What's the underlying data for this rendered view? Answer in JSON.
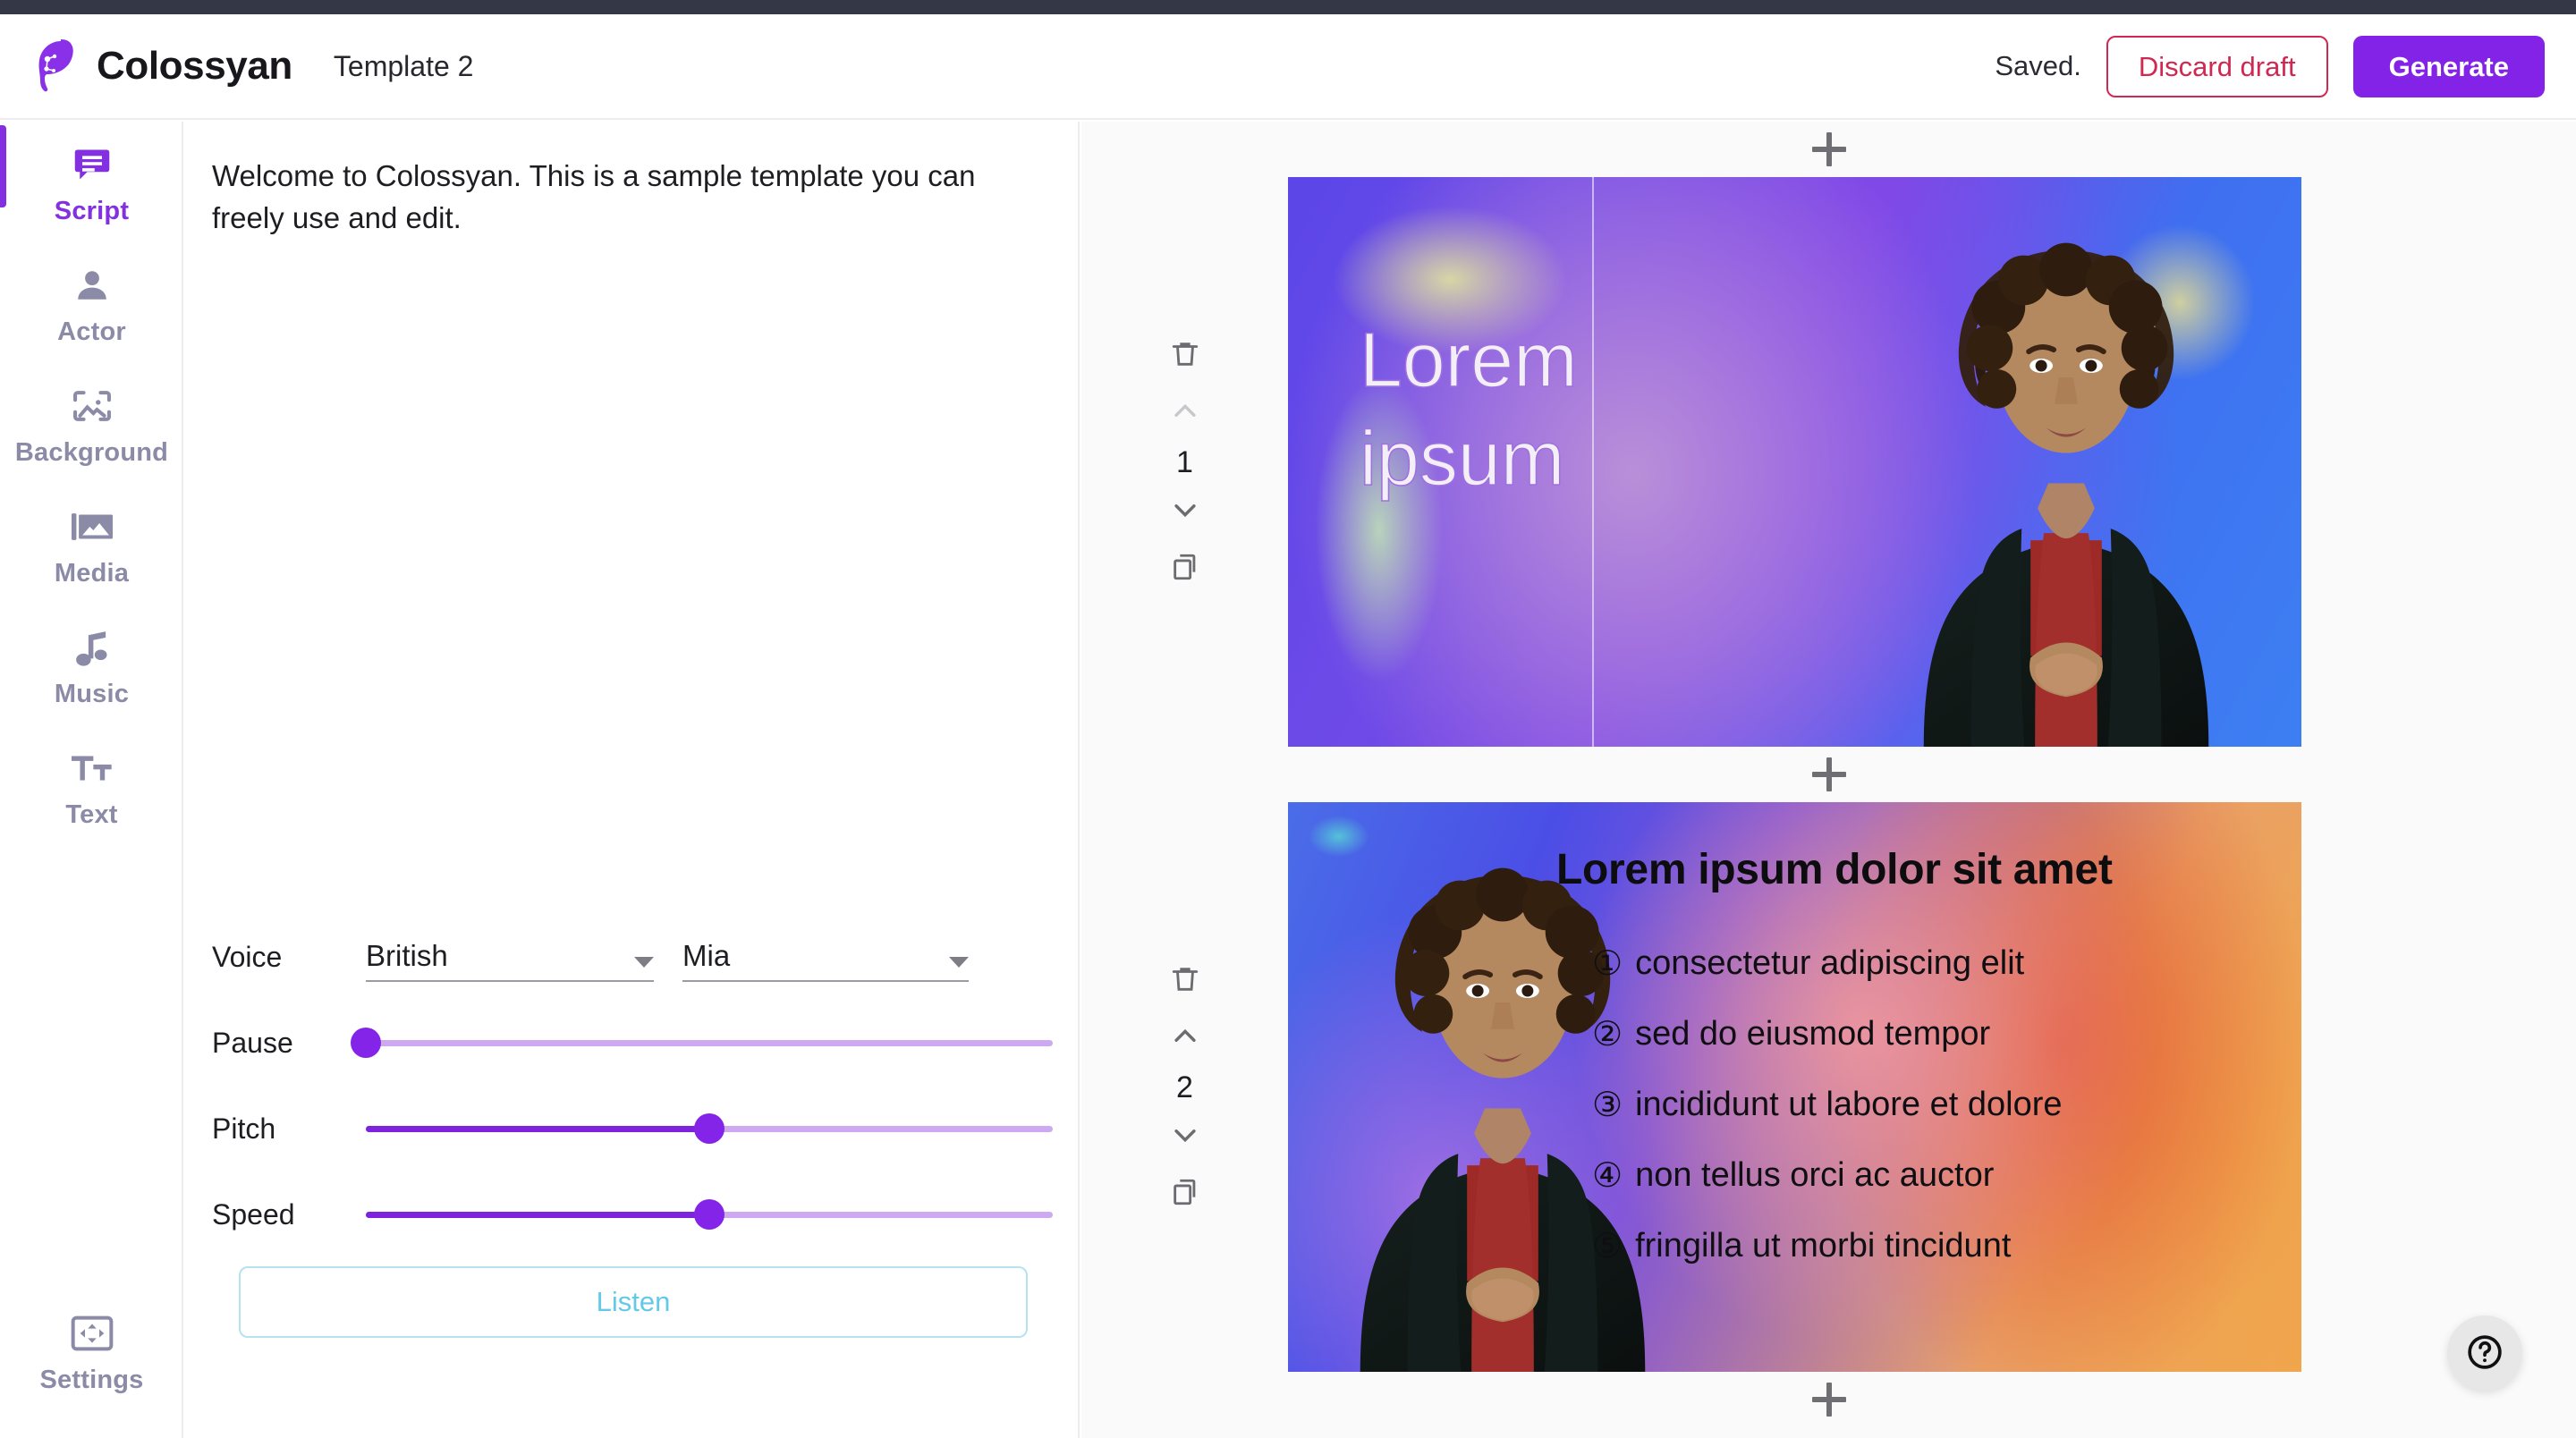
{
  "app": {
    "brand_name": "Colossyan",
    "logo_icon": "colossyan-head-logo",
    "document_title": "Template 2"
  },
  "header": {
    "save_status": "Saved.",
    "discard_label": "Discard draft",
    "generate_label": "Generate",
    "accent_color": "#8423e8",
    "danger_color": "#d02853"
  },
  "sidebar": {
    "items": [
      {
        "label": "Script",
        "icon": "chat-bubble-icon",
        "active": true
      },
      {
        "label": "Actor",
        "icon": "person-icon",
        "active": false
      },
      {
        "label": "Background",
        "icon": "image-frame-icon",
        "active": false
      },
      {
        "label": "Media",
        "icon": "photo-stack-icon",
        "active": false
      },
      {
        "label": "Music",
        "icon": "music-note-icon",
        "active": false
      },
      {
        "label": "Text",
        "icon": "text-format-icon",
        "active": false
      }
    ],
    "settings": {
      "label": "Settings",
      "icon": "aspect-ratio-icon"
    }
  },
  "script_panel": {
    "script_text": "Welcome to Colossyan. This is a sample template you can freely use and edit.",
    "voice": {
      "label": "Voice",
      "accent": {
        "value": "British",
        "caret_icon": "chevron-down-icon"
      },
      "actor": {
        "value": "Mia",
        "caret_icon": "chevron-down-icon"
      }
    },
    "sliders": [
      {
        "label": "Pause",
        "percent": 0
      },
      {
        "label": "Pitch",
        "percent": 50
      },
      {
        "label": "Speed",
        "percent": 50
      }
    ],
    "listen_label": "Listen"
  },
  "scenes": {
    "add_scene_icon": "plus-icon",
    "controls": {
      "delete_icon": "trash-icon",
      "move_up_icon": "chevron-up-icon",
      "move_down_icon": "chevron-down-icon",
      "duplicate_icon": "copy-icon"
    },
    "list": [
      {
        "index": "1",
        "move_up_disabled": true,
        "title_lines": [
          "Lorem",
          "ipsum"
        ],
        "actor_name": "presenter-actor"
      },
      {
        "index": "2",
        "move_up_disabled": false,
        "heading": "Lorem ipsum dolor sit amet",
        "bullets": [
          {
            "marker": "①",
            "text": "consectetur adipiscing elit"
          },
          {
            "marker": "②",
            "text": "sed do eiusmod tempor"
          },
          {
            "marker": "③",
            "text": "incididunt ut labore et dolore"
          },
          {
            "marker": "④",
            "text": "non tellus orci ac auctor"
          },
          {
            "marker": "⑤",
            "text": "fringilla ut morbi tincidunt"
          }
        ],
        "actor_name": "presenter-actor"
      }
    ]
  },
  "help": {
    "icon": "question-mark-circle-icon"
  }
}
